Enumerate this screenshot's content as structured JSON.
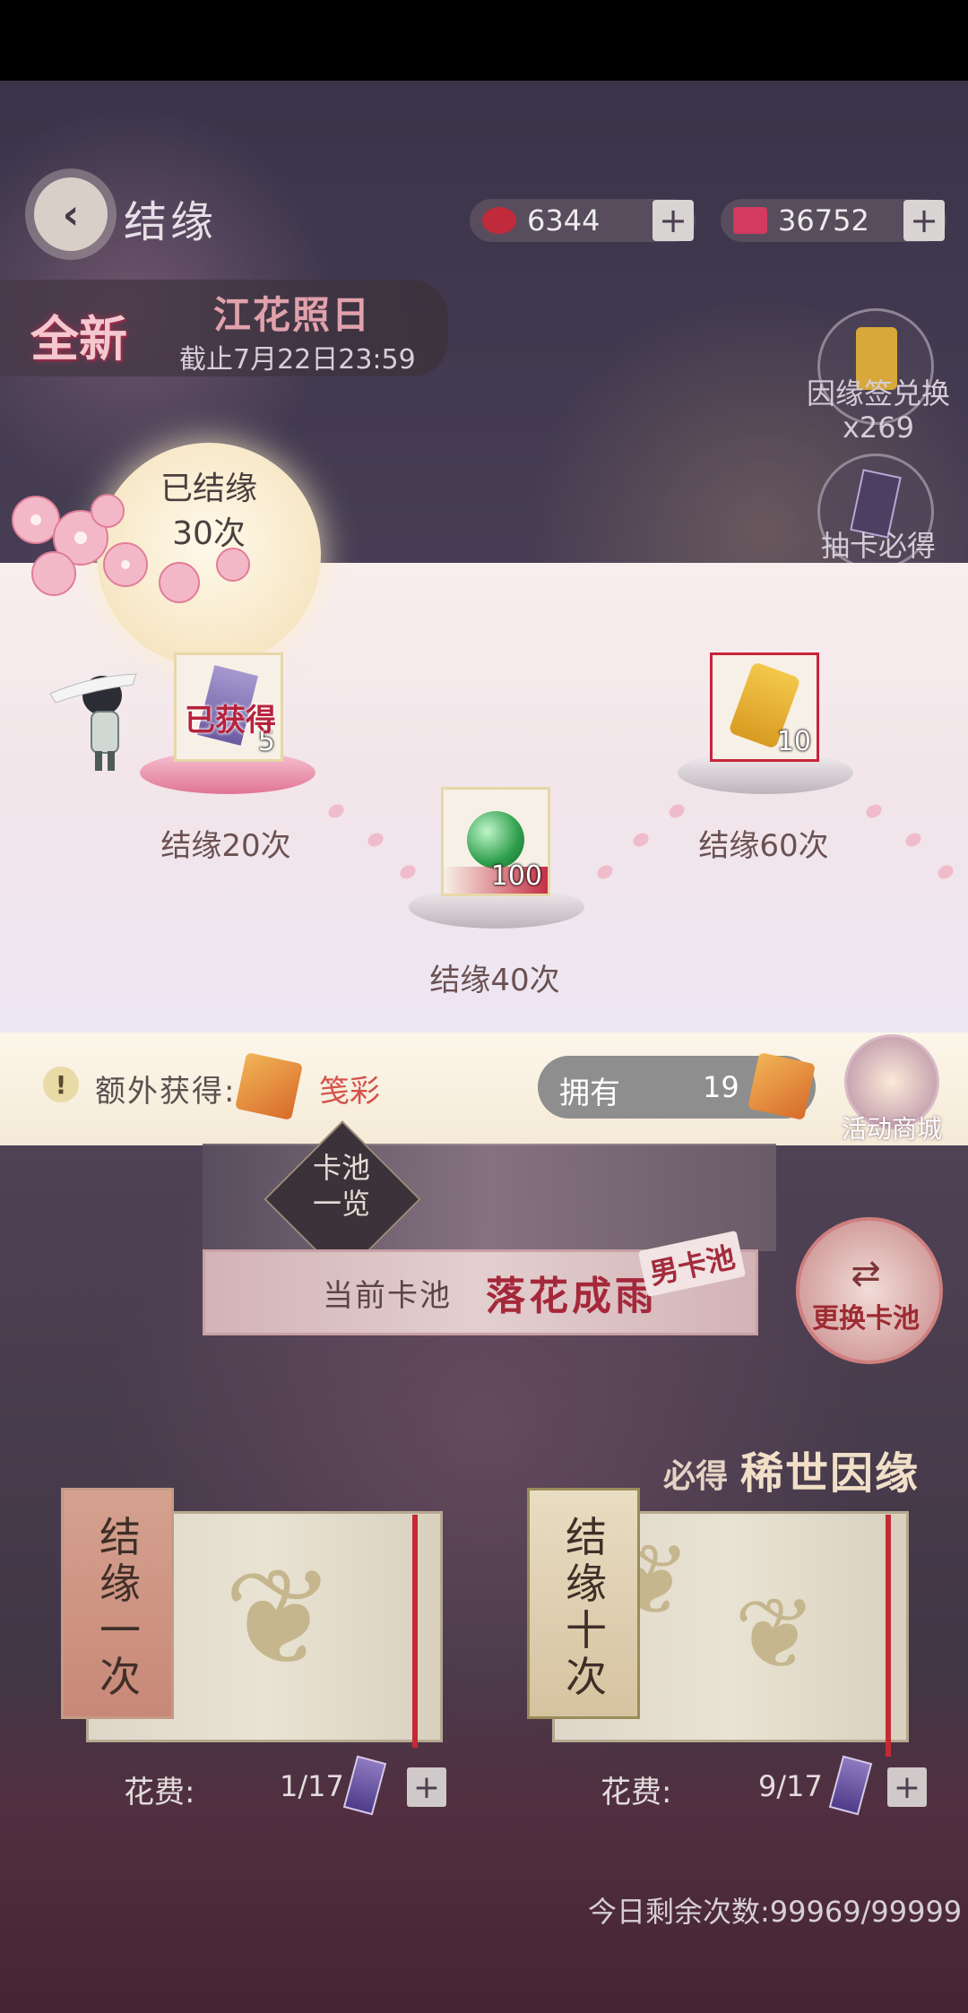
{
  "header": {
    "title": "结缘",
    "currency_jade": "6344",
    "currency_butterfly": "36752",
    "plus": "+"
  },
  "event": {
    "badge": "全新",
    "name": "江花照日",
    "deadline": "截止7月22日23:59"
  },
  "side": {
    "exchange_label": "因缘签兑换",
    "exchange_count": "x269",
    "guarantee_label": "抽卡必得"
  },
  "progress": {
    "line1": "已结缘",
    "line2": "30次"
  },
  "milestones": [
    {
      "label": "结缘20次",
      "count": "5",
      "claimed": "已获得"
    },
    {
      "label": "结缘40次",
      "count": "100"
    },
    {
      "label": "结缘60次",
      "count": "10"
    }
  ],
  "extra": {
    "icon": "!",
    "label": "额外获得:",
    "item": "笺彩",
    "owned_label": "拥有",
    "owned_value": "19",
    "shop_label": "活动商城"
  },
  "pool": {
    "overview_1": "卡池",
    "overview_2": "一览",
    "prefix": "当前卡池",
    "name": "落花成雨",
    "tag": "男卡池",
    "switch_arrows": "⇄",
    "switch_label": "更换卡池",
    "guarantee_prefix": "必得",
    "guarantee_text": "稀世因缘"
  },
  "draws": [
    {
      "tab": [
        "结",
        "缘",
        "一",
        "次"
      ],
      "cost_label": "花费:",
      "cost_value": "1/17"
    },
    {
      "tab": [
        "结",
        "缘",
        "十",
        "次"
      ],
      "cost_label": "花费:",
      "cost_value": "9/17"
    }
  ],
  "remaining": "今日剩余次数:99969/99999",
  "colors": {
    "accent_red": "#a5283a",
    "panel_bg": "#f2e5ea",
    "bar_bg": "#fcf6ea"
  }
}
